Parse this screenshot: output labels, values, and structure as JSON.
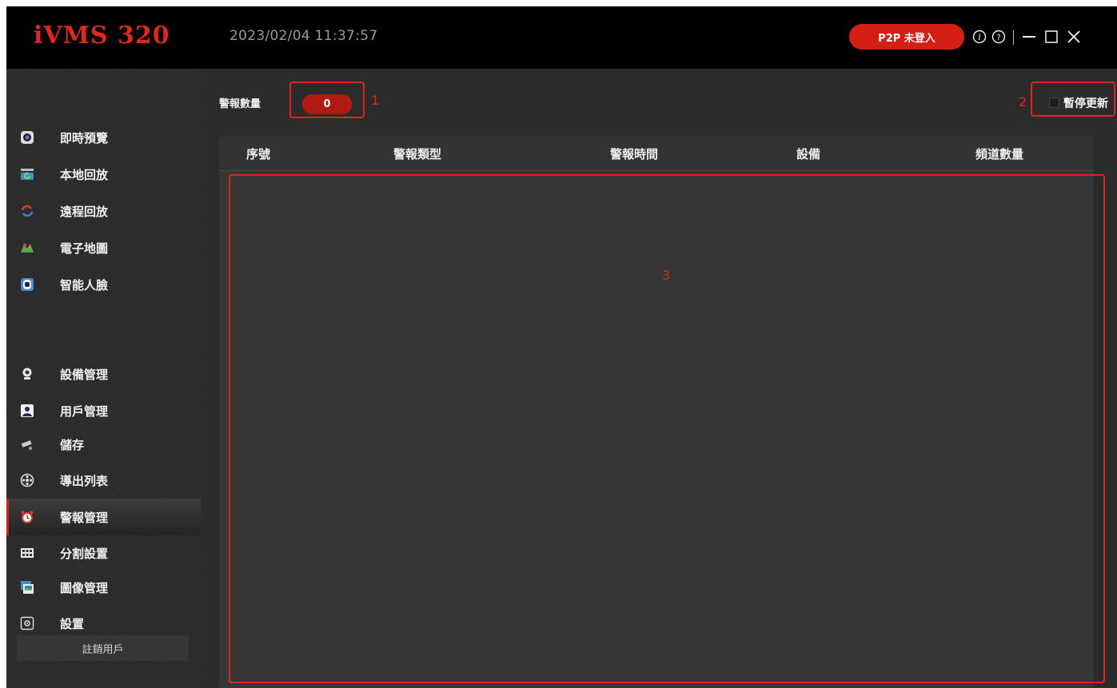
{
  "app": {
    "logo": "iVMS 320",
    "datetime": "2023/02/04 11:37:57",
    "p2p_button": "P2P 未登入",
    "icons": [
      "info-icon",
      "help-icon",
      "minimize-icon",
      "maximize-icon",
      "close-icon"
    ]
  },
  "sidebar": {
    "items": [
      {
        "label": "即時預覽",
        "icon": "live-view-icon"
      },
      {
        "label": "本地回放",
        "icon": "local-playback-icon"
      },
      {
        "label": "遠程回放",
        "icon": "remote-playback-icon"
      },
      {
        "label": "電子地圖",
        "icon": "e-map-icon"
      },
      {
        "label": "智能人臉",
        "icon": "face-recognition-icon"
      },
      {
        "label": "設備管理",
        "icon": "device-management-icon"
      },
      {
        "label": "用戶管理",
        "icon": "user-management-icon"
      },
      {
        "label": "儲存",
        "icon": "storage-icon"
      },
      {
        "label": "導出列表",
        "icon": "export-list-icon"
      },
      {
        "label": "警報管理",
        "icon": "alarm-clock-icon",
        "active": true
      },
      {
        "label": "分割設置",
        "icon": "split-layout-icon"
      },
      {
        "label": "圖像管理",
        "icon": "image-management-icon"
      },
      {
        "label": "設置",
        "icon": "settings-icon"
      }
    ],
    "logout": "註銷用戶"
  },
  "alarm": {
    "count_label": "警報數量",
    "count": "0",
    "pause_label": "暫停更新",
    "pause_checked": false
  },
  "table": {
    "columns": [
      "序號",
      "警報類型",
      "警報時間",
      "設備",
      "頻道數量"
    ],
    "rows": []
  },
  "annotations": [
    "1",
    "2",
    "3"
  ],
  "colors": {
    "accent": "#d61f14",
    "background": "#2b2b2b",
    "titlebar": "#000000",
    "annotation": "#e0261b"
  }
}
